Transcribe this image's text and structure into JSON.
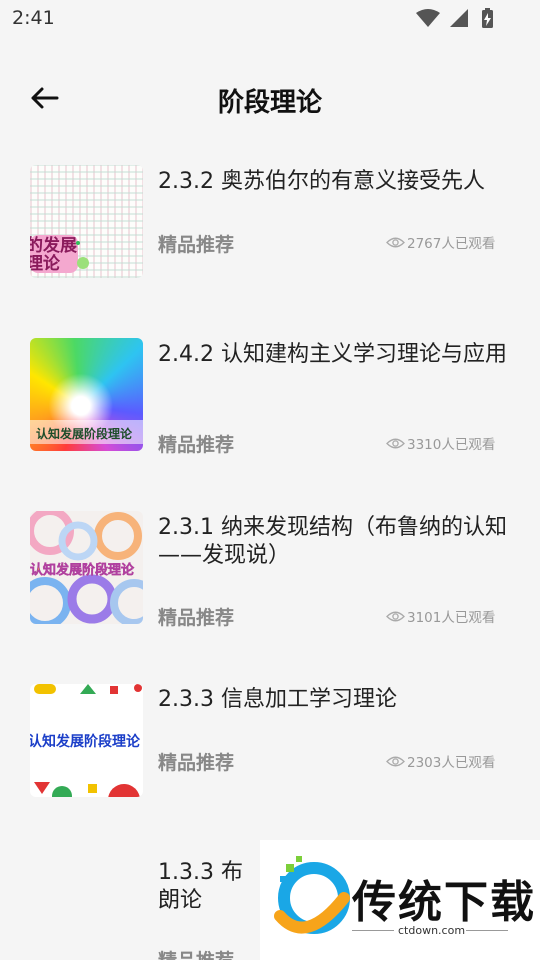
{
  "status": {
    "time": "2:41"
  },
  "header": {
    "title": "阶段理论"
  },
  "items": [
    {
      "title": "2.3.2 奥苏伯尔的有意义接受先人",
      "tag": "精品推荐",
      "views": "2767人已观看",
      "thumb_text": "认知发展阶段理论"
    },
    {
      "title": "2.4.2 认知建构主义学习理论与应用",
      "tag": "精品推荐",
      "views": "3310人已观看",
      "thumb_text": "认知发展阶段理论"
    },
    {
      "title": "2.3.1 纳来发现结构（布鲁纳的认知——发现说）",
      "tag": "精品推荐",
      "views": "3101人已观看",
      "thumb_text": "认知发展阶段理论"
    },
    {
      "title": "2.3.3 信息加工学习理论",
      "tag": "精品推荐",
      "views": "2303人已观看",
      "thumb_text": "认知发展阶段理论"
    },
    {
      "title": "1.3.3 布朗论",
      "tag": "精品推荐",
      "views": "",
      "thumb_text": ""
    }
  ],
  "watermark": {
    "text": "传统下载",
    "sub": "ctdown.com"
  }
}
